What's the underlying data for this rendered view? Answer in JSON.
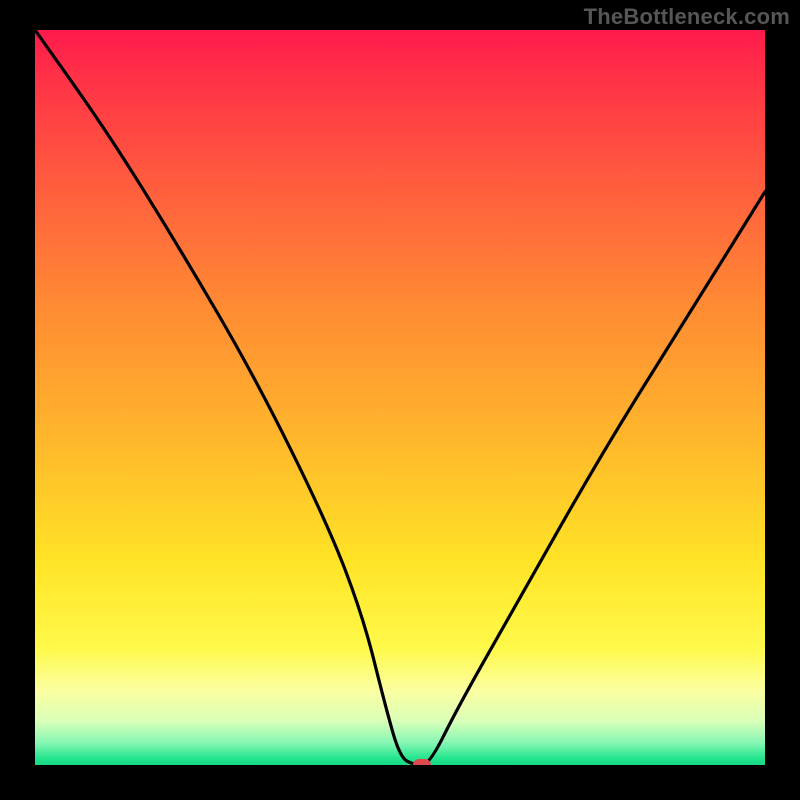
{
  "watermark": "TheBottleneck.com",
  "chart_data": {
    "type": "line",
    "title": "",
    "xlabel": "",
    "ylabel": "",
    "xlim": [
      0,
      100
    ],
    "ylim": [
      0,
      100
    ],
    "grid": false,
    "series": [
      {
        "name": "bottleneck-curve",
        "x": [
          0,
          10,
          20,
          30,
          40,
          45,
          48,
          50,
          52,
          54,
          58,
          66,
          78,
          90,
          100
        ],
        "values": [
          100,
          86,
          70,
          53,
          33,
          20,
          8,
          1,
          0,
          0,
          8,
          22,
          43,
          62,
          78
        ]
      }
    ],
    "marker": {
      "x": 53,
      "y": 0,
      "color": "#e04a4f"
    },
    "gradient_stops": [
      {
        "pct": 0,
        "color": "#ff1a4d"
      },
      {
        "pct": 20,
        "color": "#ff5a3f"
      },
      {
        "pct": 55,
        "color": "#ffb52c"
      },
      {
        "pct": 84,
        "color": "#fff94a"
      },
      {
        "pct": 97,
        "color": "#86f7b4"
      },
      {
        "pct": 100,
        "color": "#17d884"
      }
    ]
  }
}
